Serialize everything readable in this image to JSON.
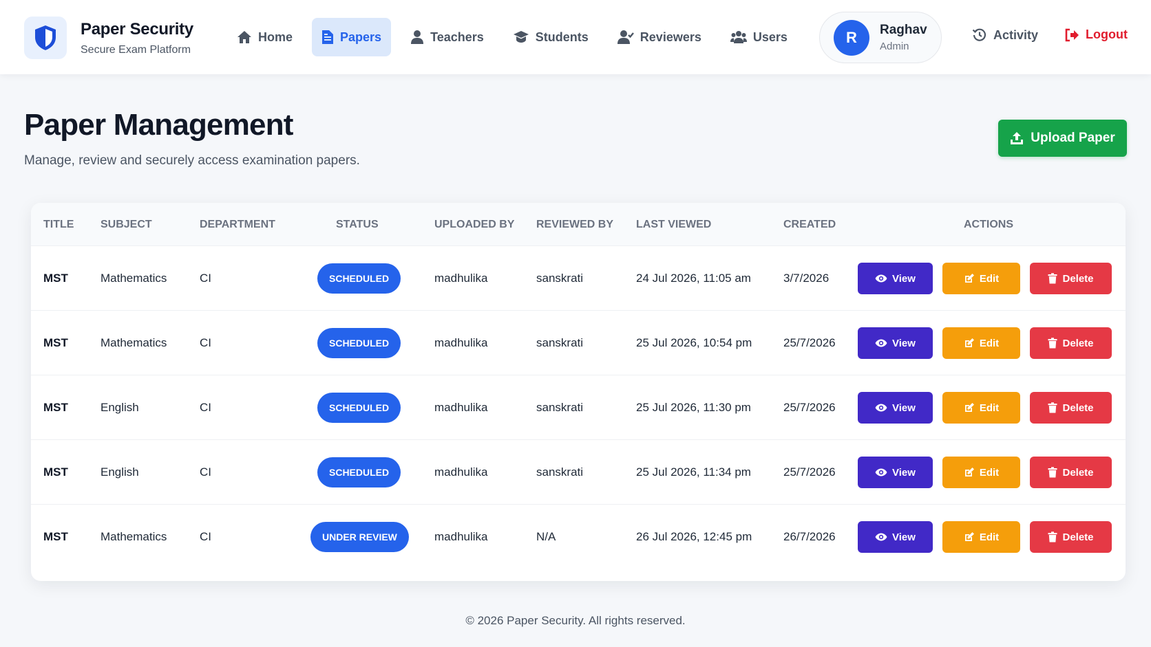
{
  "brand": {
    "title": "Paper Security",
    "subtitle": "Secure Exam Platform",
    "icon": "shield-icon"
  },
  "nav": [
    {
      "label": "Home",
      "icon": "home-icon",
      "active": false
    },
    {
      "label": "Papers",
      "icon": "document-icon",
      "active": true
    },
    {
      "label": "Teachers",
      "icon": "user-icon",
      "active": false
    },
    {
      "label": "Students",
      "icon": "graduation-cap-icon",
      "active": false
    },
    {
      "label": "Reviewers",
      "icon": "user-check-icon",
      "active": false
    },
    {
      "label": "Users",
      "icon": "users-icon",
      "active": false
    }
  ],
  "user": {
    "initial": "R",
    "name": "Raghav",
    "role": "Admin"
  },
  "header_links": {
    "activity": "Activity",
    "logout": "Logout"
  },
  "page": {
    "title": "Paper Management",
    "subtitle": "Manage, review and securely access examination papers.",
    "upload_label": "Upload Paper"
  },
  "table": {
    "columns": [
      "TITLE",
      "SUBJECT",
      "DEPARTMENT",
      "STATUS",
      "UPLOADED BY",
      "REVIEWED BY",
      "LAST VIEWED",
      "CREATED",
      "ACTIONS"
    ],
    "rows": [
      {
        "title": "MST",
        "subject": "Mathematics",
        "department": "CI",
        "status": "SCHEDULED",
        "uploaded_by": "madhulika",
        "reviewed_by": "sanskrati",
        "last_viewed": "24 Jul 2026, 11:05 am",
        "created": "3/7/2026"
      },
      {
        "title": "MST",
        "subject": "Mathematics",
        "department": "CI",
        "status": "SCHEDULED",
        "uploaded_by": "madhulika",
        "reviewed_by": "sanskrati",
        "last_viewed": "25 Jul 2026, 10:54 pm",
        "created": "25/7/2026"
      },
      {
        "title": "MST",
        "subject": "English",
        "department": "CI",
        "status": "SCHEDULED",
        "uploaded_by": "madhulika",
        "reviewed_by": "sanskrati",
        "last_viewed": "25 Jul 2026, 11:30 pm",
        "created": "25/7/2026"
      },
      {
        "title": "MST",
        "subject": "English",
        "department": "CI",
        "status": "SCHEDULED",
        "uploaded_by": "madhulika",
        "reviewed_by": "sanskrati",
        "last_viewed": "25 Jul 2026, 11:34 pm",
        "created": "25/7/2026"
      },
      {
        "title": "MST",
        "subject": "Mathematics",
        "department": "CI",
        "status": "UNDER REVIEW",
        "uploaded_by": "madhulika",
        "reviewed_by": "N/A",
        "last_viewed": "26 Jul 2026, 12:45 pm",
        "created": "26/7/2026"
      }
    ],
    "actions": {
      "view": "View",
      "edit": "Edit",
      "delete": "Delete"
    }
  },
  "footer": "© 2026 Paper Security. All rights reserved.",
  "colors": {
    "primary": "#2563eb",
    "view": "#4129c7",
    "edit": "#f59e0b",
    "delete": "#e53945",
    "upload": "#16a34a",
    "logout": "#e11d2e"
  }
}
